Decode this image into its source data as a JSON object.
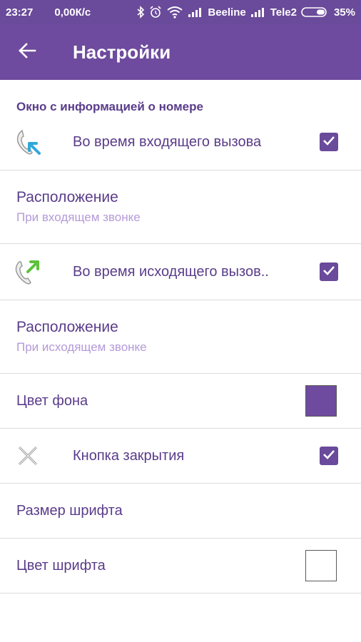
{
  "status_bar": {
    "time": "23:27",
    "net_speed": "0,00К/с",
    "carrier1": "Beeline",
    "carrier2": "Tele2",
    "battery": "35%",
    "icons": [
      "bluetooth-icon",
      "alarm-icon",
      "wifi-icon",
      "signal-icon",
      "battery-icon"
    ]
  },
  "app_bar": {
    "title": "Настройки",
    "back_icon": "arrow-left-icon"
  },
  "section": {
    "header": "Окно с информацией о номере"
  },
  "rows": {
    "incoming": {
      "label": "Во время входящего вызова",
      "icon": "incoming-call-icon",
      "checked": true
    },
    "incoming_position": {
      "label": "Расположение",
      "value": "При входящем звонке"
    },
    "outgoing": {
      "label": "Во время исходящего вызов..",
      "icon": "outgoing-call-icon",
      "checked": true
    },
    "outgoing_position": {
      "label": "Расположение",
      "value": "При исходящем звонке"
    },
    "bg_color": {
      "label": "Цвет фона",
      "color": "#6e4b9e"
    },
    "close_button": {
      "label": "Кнопка закрытия",
      "icon": "close-x-icon",
      "checked": true
    },
    "font_size": {
      "label": "Размер шрифта"
    },
    "font_color": {
      "label": "Цвет шрифта",
      "color": "#ffffff"
    }
  },
  "colors": {
    "primary": "#6e4b9e",
    "status_bar": "#6a4a9a",
    "text_primary": "#5a3c8a",
    "text_secondary": "#b49ad8",
    "divider": "#dcdcdc"
  }
}
